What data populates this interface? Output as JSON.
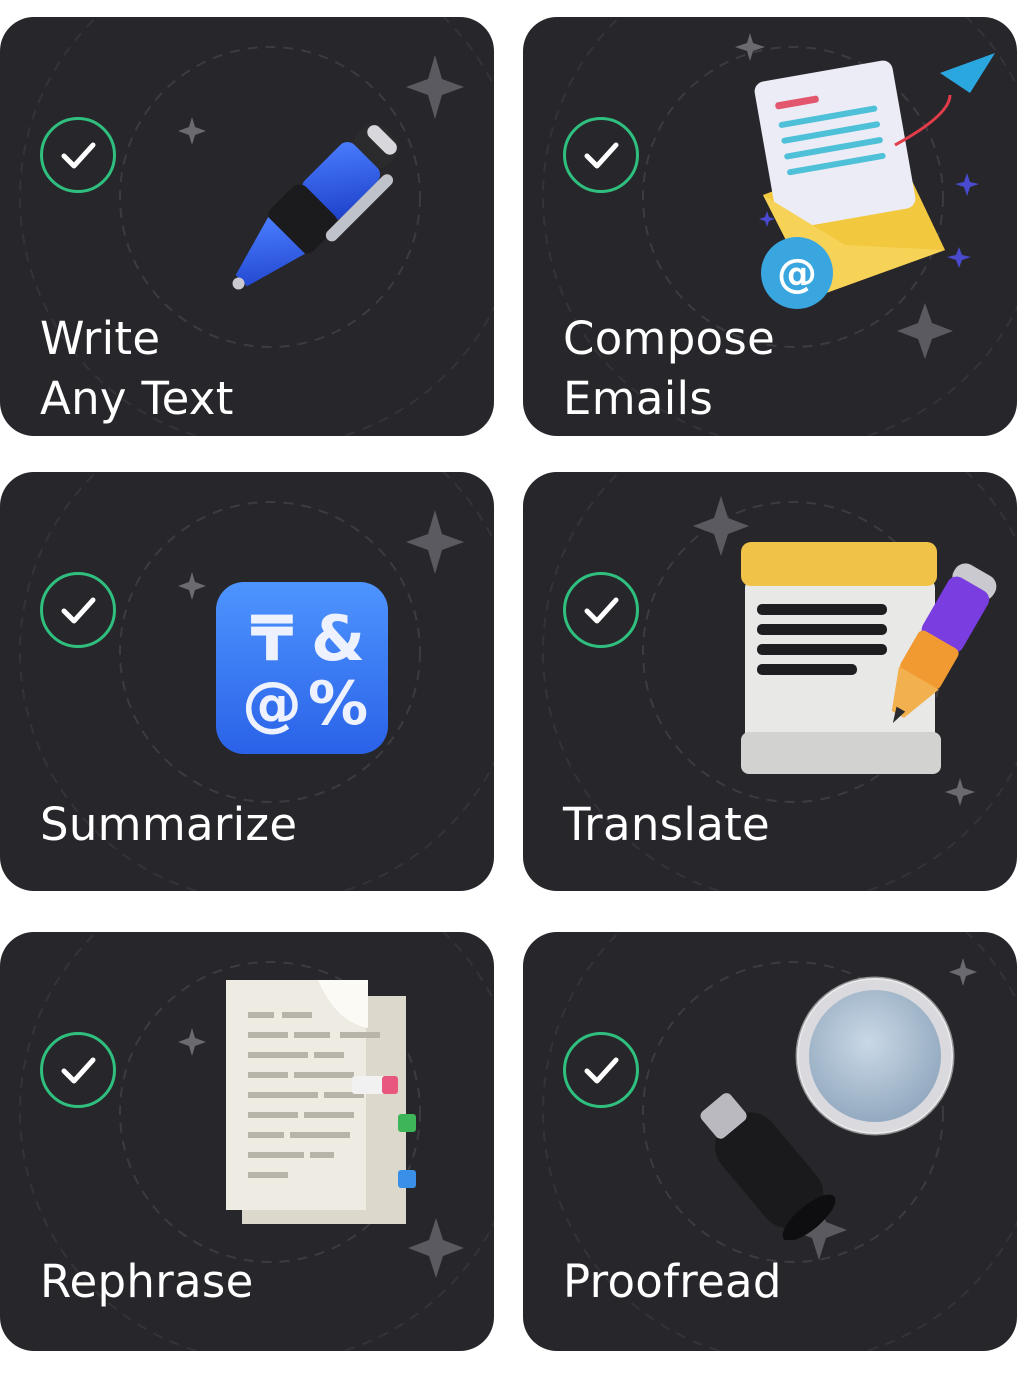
{
  "colors": {
    "card_background": "#27272b",
    "check_green": "#2fbf7f",
    "text": "#ffffff",
    "star": "#5a5a60"
  },
  "cards": [
    {
      "lines": [
        "Write",
        "Any Text"
      ],
      "icon": "pen-icon"
    },
    {
      "lines": [
        "Compose",
        "Emails"
      ],
      "icon": "envelope-icon"
    },
    {
      "lines": [
        "Summarize"
      ],
      "icon": "symbols-icon"
    },
    {
      "lines": [
        "Translate"
      ],
      "icon": "notepad-pencil-icon"
    },
    {
      "lines": [
        "Rephrase"
      ],
      "icon": "documents-icon"
    },
    {
      "lines": [
        "Proofread"
      ],
      "icon": "magnifier-icon"
    }
  ],
  "symbols_icon": {
    "glyphs": [
      "₸",
      "&",
      "@",
      "%"
    ]
  },
  "email_icon": {
    "at": "@"
  }
}
